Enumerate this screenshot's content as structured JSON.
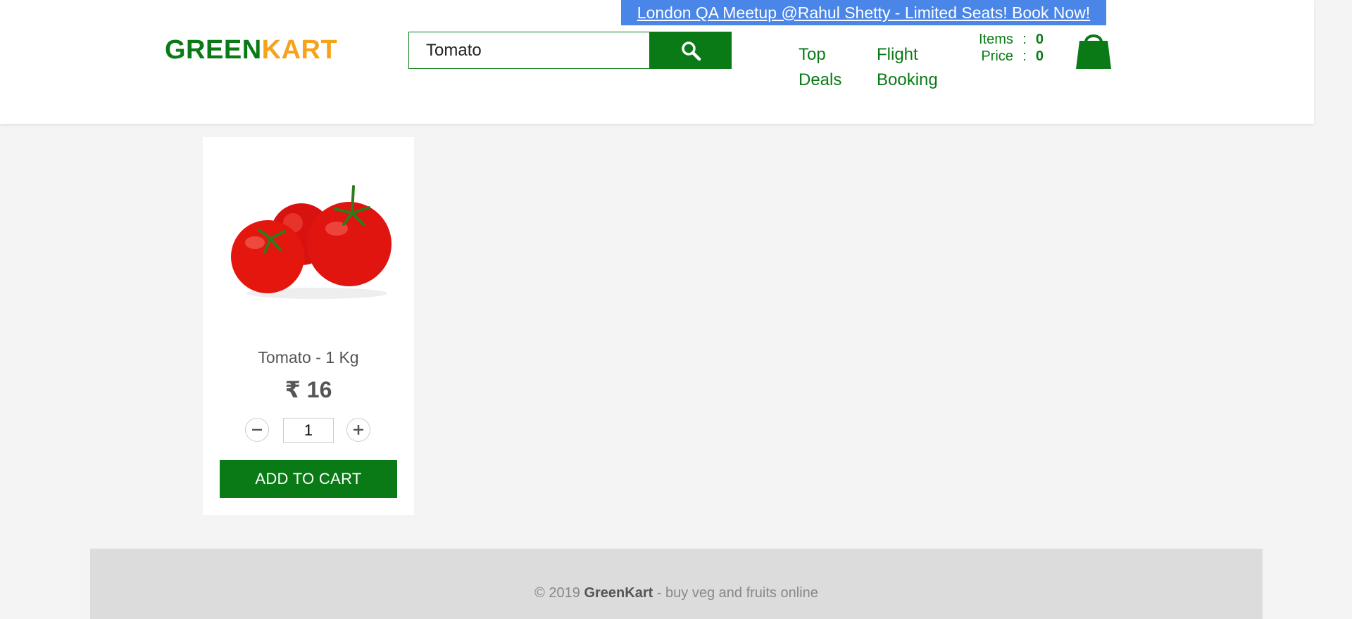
{
  "promo": {
    "text": "London QA Meetup @Rahul Shetty - Limited Seats! Book Now!"
  },
  "logo": {
    "part1": "GREEN",
    "part2": "KART"
  },
  "search": {
    "value": "Tomato",
    "button_icon": "search-icon"
  },
  "nav": {
    "top_deals": [
      "Top",
      "Deals"
    ],
    "flight_booking": [
      "Flight",
      "Booking"
    ]
  },
  "cart": {
    "items_label": "Items",
    "items_value": "0",
    "price_label": "Price",
    "price_value": "0",
    "separator": ":",
    "icon": "shopping-bag-icon"
  },
  "products": [
    {
      "name": "Tomato - 1 Kg",
      "price": "₹ 16",
      "quantity": "1",
      "add_label": "ADD TO CART",
      "image": "tomato-image"
    }
  ],
  "footer": {
    "prefix": "© 2019 ",
    "brand": "GreenKart",
    "suffix": " - buy veg and fruits online"
  },
  "colors": {
    "brand_green": "#0a7a16",
    "brand_orange": "#f7a21b",
    "promo_blue": "#4a86e8",
    "background": "#f4f4f4",
    "footer": "#dcdcdc"
  }
}
